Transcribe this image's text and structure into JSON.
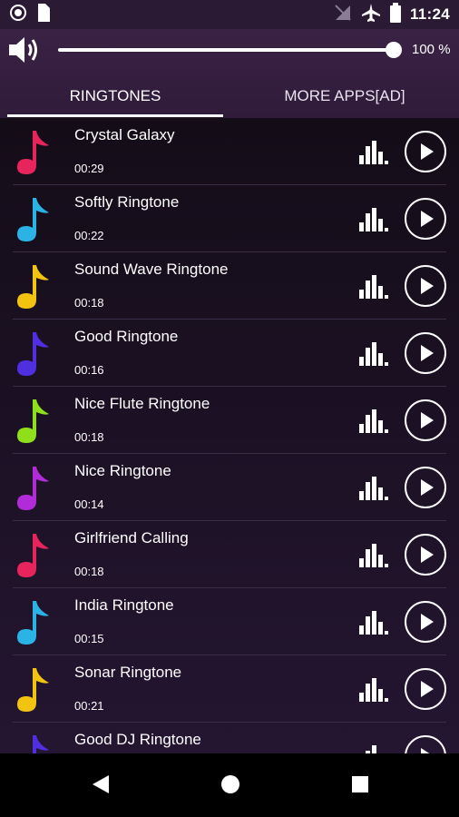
{
  "status_bar": {
    "time": "11:24",
    "left_icons": [
      "record-icon",
      "sim-icon"
    ],
    "right_icons": [
      "no-signal-icon",
      "airplane-icon",
      "battery-icon"
    ]
  },
  "volume": {
    "percent_label": "100 %",
    "level": 1.0
  },
  "tabs": [
    {
      "label": "RINGTONES",
      "active": true
    },
    {
      "label": "MORE APPS[AD]",
      "active": false
    }
  ],
  "ringtones": [
    {
      "title": "Crystal Galaxy",
      "duration": "00:29",
      "color": "#e8245c"
    },
    {
      "title": "Softly Ringtone",
      "duration": "00:22",
      "color": "#2bb3e6"
    },
    {
      "title": "Sound Wave Ringtone",
      "duration": "00:18",
      "color": "#f2c40f"
    },
    {
      "title": "Good Ringtone",
      "duration": "00:16",
      "color": "#4f2fe0"
    },
    {
      "title": "Nice Flute Ringtone",
      "duration": "00:18",
      "color": "#8fe01a"
    },
    {
      "title": "Nice Ringtone",
      "duration": "00:14",
      "color": "#b22bd8"
    },
    {
      "title": "Girlfriend Calling",
      "duration": "00:18",
      "color": "#e8245c"
    },
    {
      "title": "India Ringtone",
      "duration": "00:15",
      "color": "#2bb3e6"
    },
    {
      "title": "Sonar Ringtone",
      "duration": "00:21",
      "color": "#f2c40f"
    },
    {
      "title": "Good DJ Ringtone",
      "duration": "",
      "color": "#4f2fe0"
    }
  ],
  "nav": [
    "back-icon",
    "home-icon",
    "recents-icon"
  ]
}
